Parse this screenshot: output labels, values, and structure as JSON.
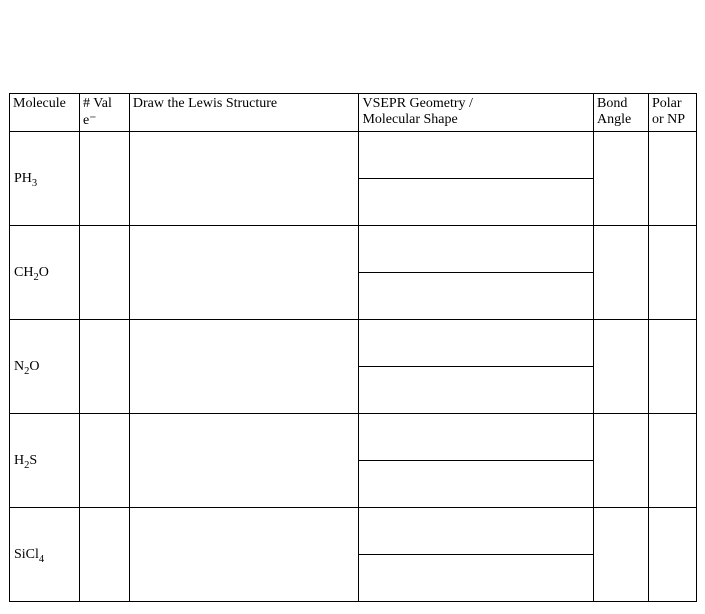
{
  "headers": {
    "molecule": "Molecule",
    "val_e": "# Val e⁻",
    "lewis": "Draw the Lewis Structure",
    "vsepr_line1": "VSEPR Geometry /",
    "vsepr_line2": "Molecular Shape",
    "bond_line1": "Bond",
    "bond_line2": "Angle",
    "polar_line1": "Polar",
    "polar_line2": "or NP"
  },
  "rows": [
    {
      "formula_html": "PH<sub>3</sub>"
    },
    {
      "formula_html": "CH<sub>2</sub>O"
    },
    {
      "formula_html": "N<sub>2</sub>O"
    },
    {
      "formula_html": "H<sub>2</sub>S"
    },
    {
      "formula_html": "SiCl<sub>4</sub>"
    }
  ]
}
